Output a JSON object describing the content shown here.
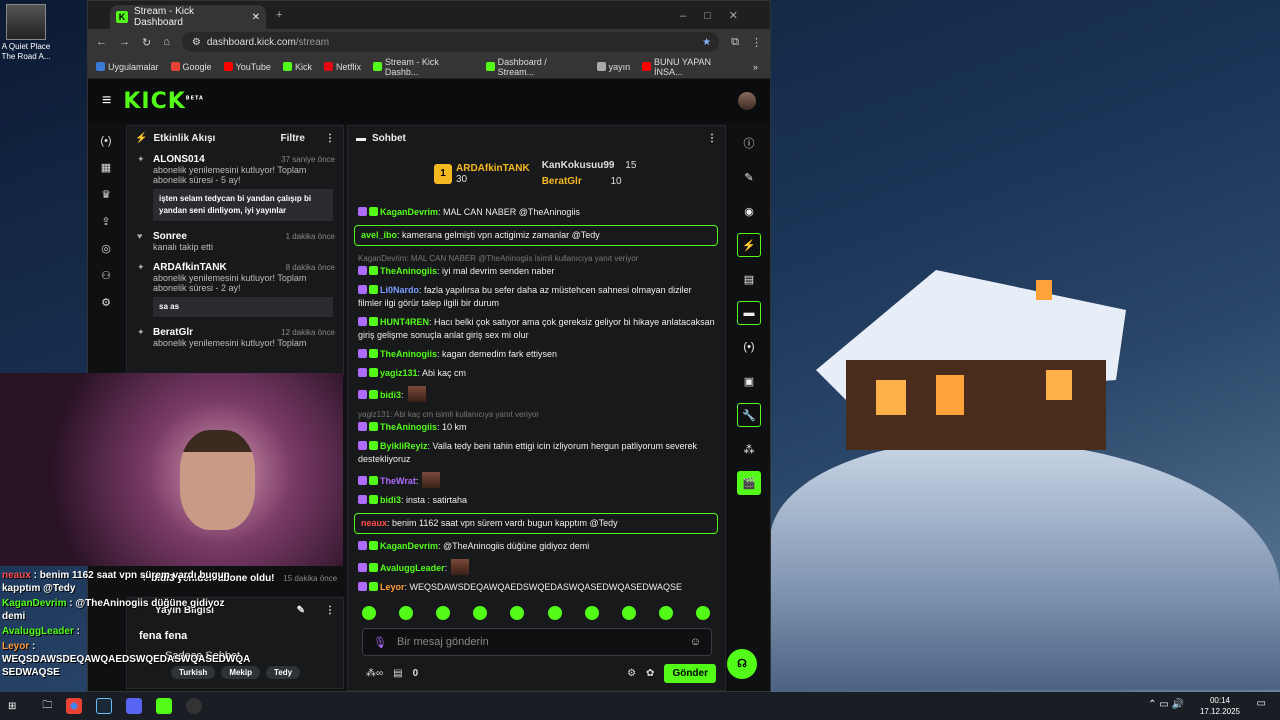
{
  "desktop": {
    "icon_label": "A Quiet Place The Road A..."
  },
  "browser": {
    "tab_title": "Stream - Kick Dashboard",
    "url_host": "dashboard.kick.com",
    "url_path": "/stream",
    "bookmarks": [
      {
        "label": "Uygulamalar",
        "color": "#3a7bd5"
      },
      {
        "label": "Google",
        "color": "#ea4335"
      },
      {
        "label": "YouTube",
        "color": "#ff0000"
      },
      {
        "label": "Kick",
        "color": "#53fc18"
      },
      {
        "label": "Netflix",
        "color": "#e50914"
      },
      {
        "label": "Stream - Kick Dashb...",
        "color": "#53fc18"
      },
      {
        "label": "Dashboard / Stream...",
        "color": "#53fc18"
      },
      {
        "label": "yayın",
        "color": "#aaaaaa"
      },
      {
        "label": "BUNU YAPAN İNSA...",
        "color": "#ff0000"
      }
    ]
  },
  "app": {
    "logo": "KICK",
    "logo_sup": "BETA"
  },
  "activity": {
    "title": "Etkinlik Akışı",
    "filter": "Filtre",
    "events": [
      {
        "name": "ALONS014",
        "time": "37 saniye önce",
        "line1": "abonelik yenilemesini kutluyor! Toplam",
        "line2": "abonelik süresi - 5 ay!",
        "quote": "işten selam tedycan bi yandan çalışıp bi yandan seni dinliyom, iyi yayınlar"
      },
      {
        "name": "Sonree",
        "time": "1 dakika önce",
        "line1": "kanalı takip etti",
        "line2": "",
        "quote": ""
      },
      {
        "name": "ARDAfkinTANK",
        "time": "8 dakika önce",
        "line1": "abonelik yenilemesini kutluyor! Toplam",
        "line2": "abonelik süresi - 2 ay!",
        "quote": "sa as"
      },
      {
        "name": "BeratGlr",
        "time": "12 dakika önce",
        "line1": "abonelik yenilemesini kutluyor! Toplam",
        "line2": "",
        "quote": ""
      }
    ],
    "bottom_event": {
      "text": "bidi3 yeniden abone oldu!",
      "time": "15 dakika önce"
    }
  },
  "stream_info": {
    "title": "Yayın Bilgisi",
    "stream_title": "fena fena",
    "category": "Sadece Sohbet",
    "tags": [
      "Turkish",
      "Mekip",
      "Tedy"
    ]
  },
  "chat": {
    "title": "Sohbet",
    "leaders": [
      {
        "rank": "1",
        "name": "ARDAfkinTANK",
        "count": "30"
      },
      {
        "rank": "",
        "name": "KanKokusuu99",
        "count": "15"
      },
      {
        "rank": "",
        "name": "BeratGlr",
        "count": "10"
      }
    ],
    "messages": [
      {
        "user": "KaganDevrim",
        "color": "#53fc18",
        "text": ": MAL CAN NABER @TheAninogiis",
        "reply": "",
        "hl": false
      },
      {
        "user": "avel_ibo",
        "color": "#53fc18",
        "text": ": kamerana gelmişti vpn actigimiz zamanlar @Tedy",
        "reply": "",
        "hl": true
      },
      {
        "user": "TheAninogiis",
        "color": "#53fc18",
        "text": ": iyi mal devrim senden naber",
        "reply": "KaganDevrim: MAL CAN NABER @TheAninogiis isimli kullanıcıya yanıt veriyor",
        "hl": false
      },
      {
        "user": "Li0Nardo",
        "color": "#7b9cff",
        "text": ": fazla yapılırsa bu sefer daha az müstehcen sahnesi olmayan diziler filmler ilgi görür talep ilgili bir durum",
        "reply": "",
        "hl": false
      },
      {
        "user": "HUNT4REN",
        "color": "#53fc18",
        "text": ": Hacı belki çok satıyor ama çok gereksiz geliyor bi hikaye anlatacaksan giriş gelişme sonuçla anlat giriş sex mi olur",
        "reply": "",
        "hl": false
      },
      {
        "user": "TheAninogiis",
        "color": "#53fc18",
        "text": ": kagan demedim fark ettiysen",
        "reply": "",
        "hl": false
      },
      {
        "user": "yagiz131",
        "color": "#53fc18",
        "text": ": Abi kaç cm",
        "reply": "",
        "hl": false
      },
      {
        "user": "bidi3",
        "color": "#53fc18",
        "text": ":",
        "reply": "",
        "hl": false
      },
      {
        "user": "TheAninogiis",
        "color": "#53fc18",
        "text": ": 10 km",
        "reply": "yagiz131: Abi kaç cm isimli kullanıcıya yanıt veriyor",
        "hl": false
      },
      {
        "user": "ByikliReyiz",
        "color": "#53fc18",
        "text": ": Valla tedy beni tahin ettigi icin izliyorum hergun patliyorum severek destekliyoruz",
        "reply": "",
        "hl": false
      },
      {
        "user": "TheWrat",
        "color": "#b06bff",
        "text": ":",
        "reply": "",
        "hl": false
      },
      {
        "user": "bidi3",
        "color": "#53fc18",
        "text": ": insta : satirtaha",
        "reply": "",
        "hl": false
      },
      {
        "user": "neaux",
        "color": "#ff4d4d",
        "text": ": benim 1162 saat vpn sürem vardı bugun kapptım @Tedy",
        "reply": "",
        "hl": true
      },
      {
        "user": "KaganDevrim",
        "color": "#53fc18",
        "text": ": @TheAninogiis düğüne gidiyoz demi",
        "reply": "",
        "hl": false
      },
      {
        "user": "AvaluggLeader",
        "color": "#53fc18",
        "text": ":",
        "reply": "",
        "hl": false
      },
      {
        "user": "Leyor",
        "color": "#ff9a3c",
        "text": ": WEQSDAWSDEQAWQAEDSWQEDASWQASEDWQASEDWAQSE",
        "reply": "",
        "hl": false
      }
    ],
    "input_placeholder": "Bir mesaj gönderin",
    "points": "0",
    "send_label": "Gönder"
  },
  "overlay": {
    "lines": [
      {
        "user": "neaux",
        "text": " : benim 1162 saat vpn sürem vardı bugun kapptım @Tedy"
      },
      {
        "user": "KaganDevrim",
        "text": " : @TheAninogiis düğüne gidiyoz demi"
      },
      {
        "user": "AvaluggLeader",
        "text": " :"
      },
      {
        "user": "Leyor",
        "text": " : WEQSDAWSDEQAWQAEDSWQEDASWQASEDWQA SEDWAQSE"
      }
    ]
  },
  "taskbar": {
    "time": "00:14",
    "date": "17.12.2025"
  }
}
